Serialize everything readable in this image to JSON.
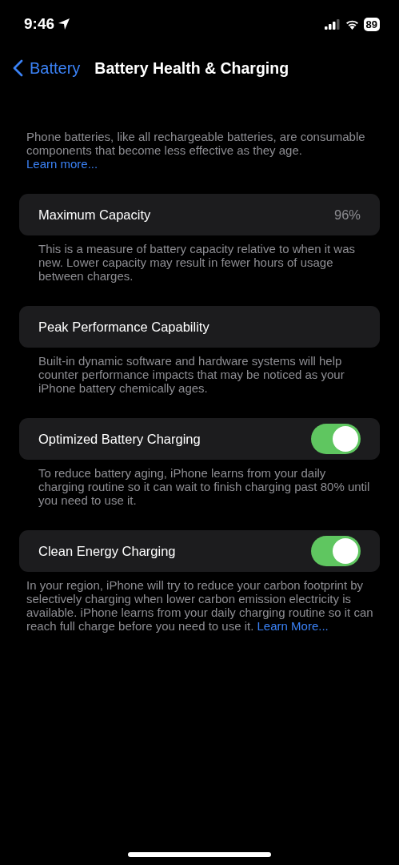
{
  "status_bar": {
    "time": "9:46",
    "battery": "89"
  },
  "nav": {
    "back": "Battery",
    "title": "Battery Health & Charging"
  },
  "intro": {
    "text": "Phone batteries, like all rechargeable batteries, are consumable components that become less effective as they age.",
    "link": "Learn more..."
  },
  "sections": [
    {
      "kind": "value",
      "label": "Maximum Capacity",
      "value": "96%",
      "footer": "This is a measure of battery capacity relative to when it was new. Lower capacity may result in fewer hours of usage between charges."
    },
    {
      "kind": "plain",
      "label": "Peak Performance Capability",
      "footer": "Built-in dynamic software and hardware systems will help counter performance impacts that may be noticed as your iPhone battery chemically ages."
    },
    {
      "kind": "toggle",
      "label": "Optimized Battery Charging",
      "on": true,
      "footer": "To reduce battery aging, iPhone learns from your daily charging routine so it can wait to finish charging past 80% until you need to use it."
    },
    {
      "kind": "toggle",
      "label": "Clean Energy Charging",
      "on": true,
      "wide_footer": true,
      "footer": "In your region, iPhone will try to reduce your carbon footprint by selectively charging when lower carbon emission electricity is available. iPhone learns from your daily charging routine so it can reach full charge before you need to use it.",
      "link": "Learn More..."
    }
  ]
}
